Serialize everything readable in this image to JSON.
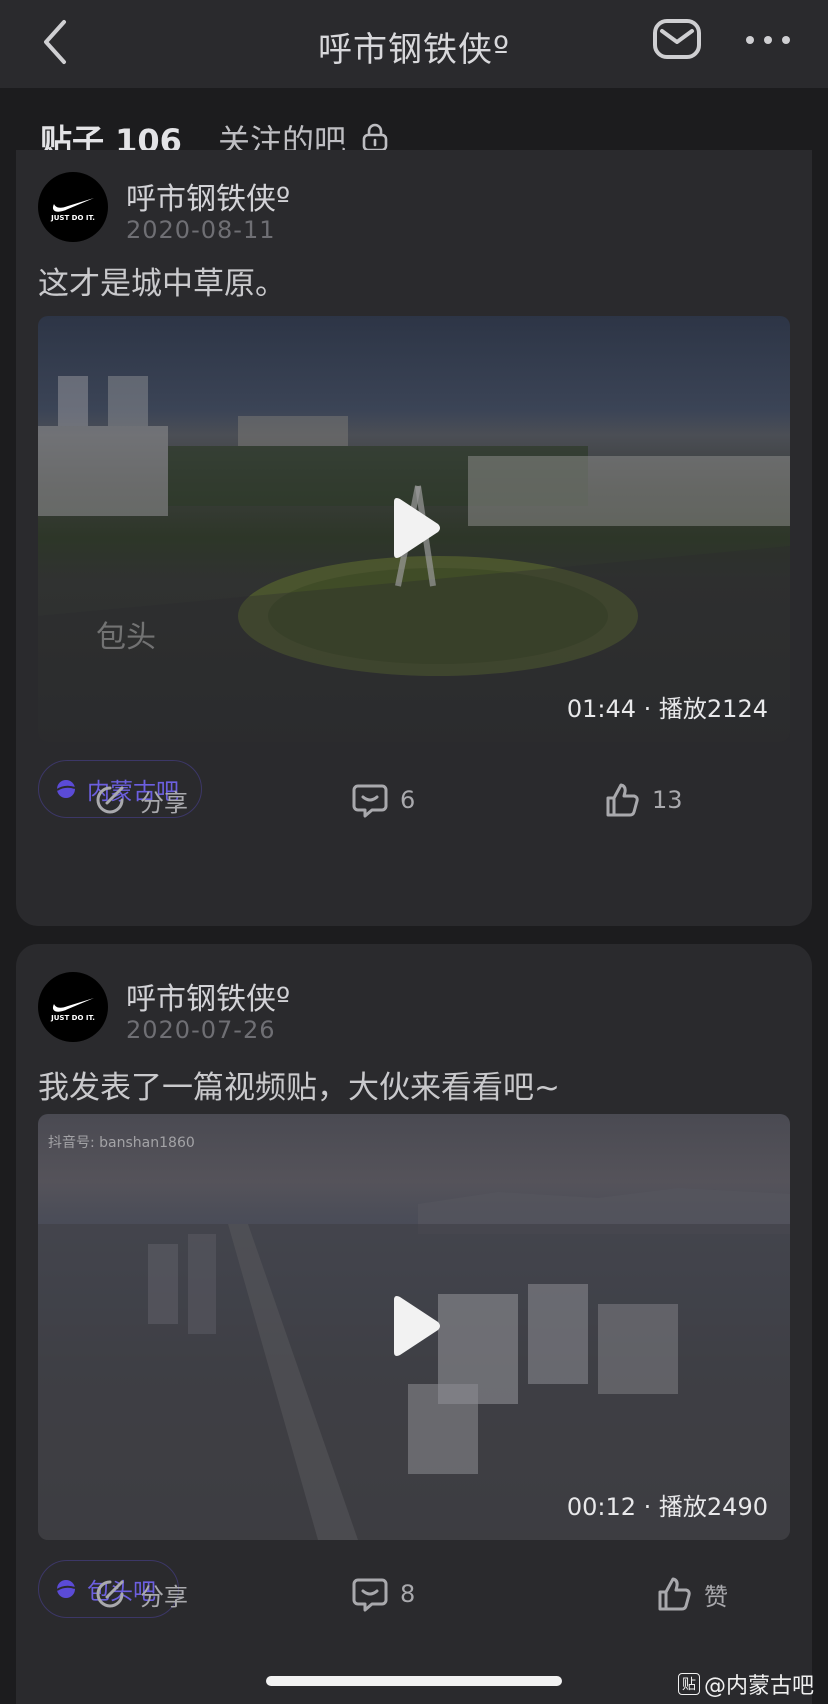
{
  "nav": {
    "title": "呼市钢铁侠º",
    "back_icon": "back-chevron-icon",
    "mail_icon": "mail-icon",
    "more_icon": "more-dots-icon"
  },
  "tabs": {
    "posts_label": "贴子 106",
    "follow_label": "关注的吧",
    "lock_icon": "lock-icon"
  },
  "posts": [
    {
      "author": "呼市钢铁侠º",
      "date": "2020-08-11",
      "text": "这才是城中草原。",
      "video_meta": "01:44 · 播放2124",
      "video_watermark": "包头",
      "forum": "内蒙古吧",
      "share_label": "分享",
      "comments": "6",
      "likes": "13"
    },
    {
      "author": "呼市钢铁侠º",
      "date": "2020-07-26",
      "text": "我发表了一篇视频贴，大伙来看看吧~",
      "video_meta": "00:12 · 播放2490",
      "video_watermark": "抖音号: banshan1860",
      "forum": "包头吧",
      "share_label": "分享",
      "comments": "8",
      "likes": "赞"
    }
  ],
  "footer": {
    "site_mark": "@内蒙古吧",
    "tieba_glyph": "贴"
  },
  "avatar_text": "JUST DO IT.",
  "colors": {
    "background": "#1c1c1e",
    "card": "#2a2a2d",
    "accent": "#5b4bd6",
    "tag_text": "#6c5fe0"
  }
}
